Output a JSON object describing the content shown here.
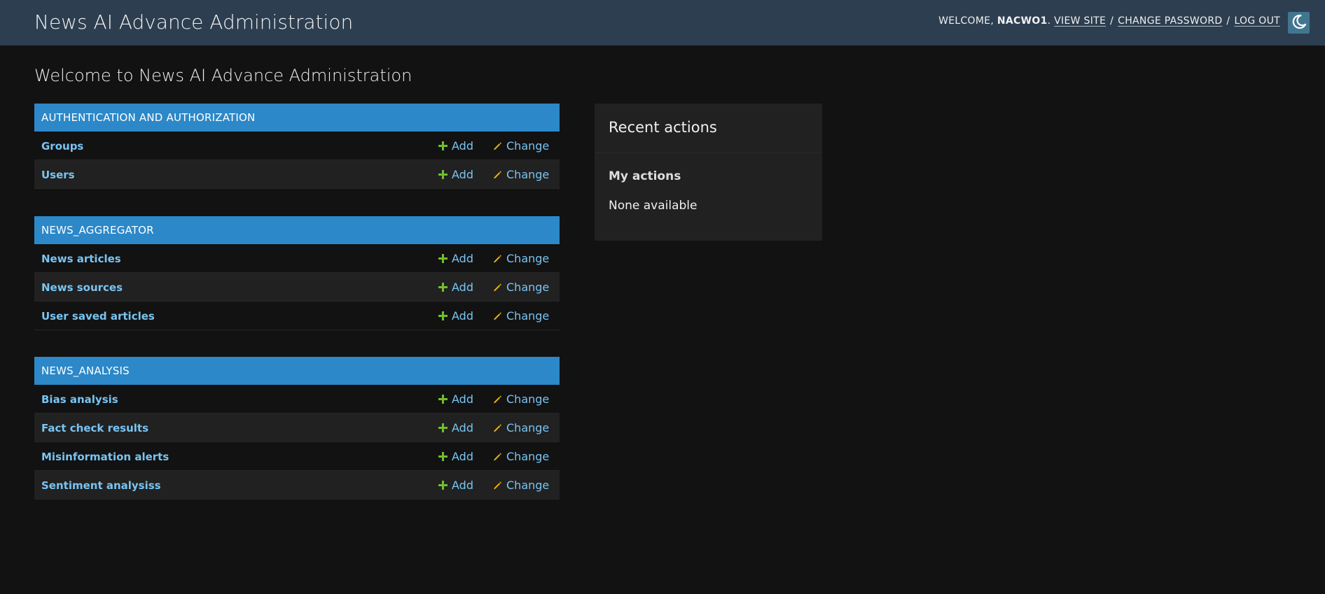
{
  "header": {
    "site_title": "News AI Advance Administration",
    "welcome": "WELCOME,",
    "username": "NACWO1",
    "view_site": "VIEW SITE",
    "change_password": "CHANGE PASSWORD",
    "log_out": "LOG OUT",
    "separator": "/",
    "theme_icon": "moon-icon"
  },
  "page": {
    "heading": "Welcome to News AI Advance Administration"
  },
  "apps": [
    {
      "caption": "AUTHENTICATION AND AUTHORIZATION",
      "models": [
        {
          "name": "Groups",
          "add": "Add",
          "change": "Change"
        },
        {
          "name": "Users",
          "add": "Add",
          "change": "Change"
        }
      ]
    },
    {
      "caption": "NEWS_AGGREGATOR",
      "models": [
        {
          "name": "News articles",
          "add": "Add",
          "change": "Change"
        },
        {
          "name": "News sources",
          "add": "Add",
          "change": "Change"
        },
        {
          "name": "User saved articles",
          "add": "Add",
          "change": "Change"
        }
      ]
    },
    {
      "caption": "NEWS_ANALYSIS",
      "models": [
        {
          "name": "Bias analysis",
          "add": "Add",
          "change": "Change"
        },
        {
          "name": "Fact check results",
          "add": "Add",
          "change": "Change"
        },
        {
          "name": "Misinformation alerts",
          "add": "Add",
          "change": "Change"
        },
        {
          "name": "Sentiment analysiss",
          "add": "Add",
          "change": "Change"
        }
      ]
    }
  ],
  "recent_actions": {
    "title": "Recent actions",
    "my_actions": "My actions",
    "empty": "None available"
  },
  "colors": {
    "header_bg": "#2d3e50",
    "caption_bg": "#2c88c8",
    "link": "#79c4f2",
    "add_icon": "#70bf2b",
    "change_icon": "#efb80b",
    "body_bg": "#121212"
  }
}
